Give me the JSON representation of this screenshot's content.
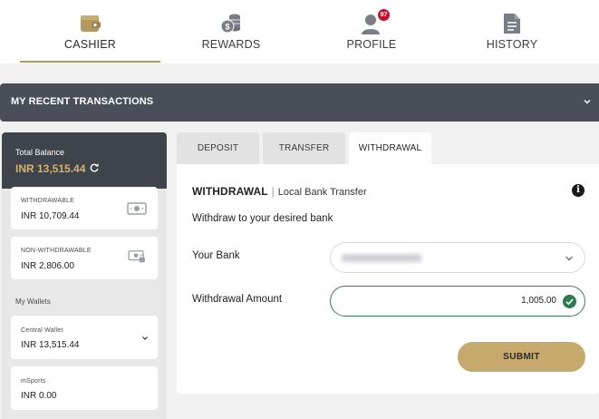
{
  "nav": {
    "items": [
      {
        "label": "CASHIER",
        "icon": "wallet-icon"
      },
      {
        "label": "REWARDS",
        "icon": "coins-icon"
      },
      {
        "label": "PROFILE",
        "icon": "user-icon",
        "badge": "97"
      },
      {
        "label": "HISTORY",
        "icon": "document-icon"
      }
    ],
    "active": "CASHIER"
  },
  "recent": {
    "title": "MY RECENT TRANSACTIONS"
  },
  "wallet": {
    "total_label": "Total Balance",
    "total_value": "INR 13,515.44",
    "withdrawable_label": "WITHDRAWABLE",
    "withdrawable_value": "INR 10,709.44",
    "nonwithdrawable_label": "NON-WITHDRAWABLE",
    "nonwithdrawable_value": "INR 2,806.00",
    "my_wallets_label": "My Wallets",
    "central_label": "Central Wallet",
    "central_value": "INR 13,515.44",
    "msports_label": "mSports",
    "msports_value": "INR 0.00"
  },
  "tabs": [
    {
      "label": "DEPOSIT"
    },
    {
      "label": "TRANSFER"
    },
    {
      "label": "WITHDRAWAL"
    }
  ],
  "form": {
    "title": "WITHDRAWAL",
    "method": "Local Bank Transfer",
    "subtitle": "Withdraw to your desired bank",
    "bank_label": "Your Bank",
    "amount_label": "Withdrawal Amount",
    "amount_value": "1,005.00",
    "submit_label": "SUBMIT"
  },
  "colors": {
    "accent_gold": "#b49a5e",
    "button_gold": "#c5a96d",
    "dark_bar": "#4a4e58",
    "success_green": "#2e7d4f",
    "badge_red": "#c8102e"
  }
}
